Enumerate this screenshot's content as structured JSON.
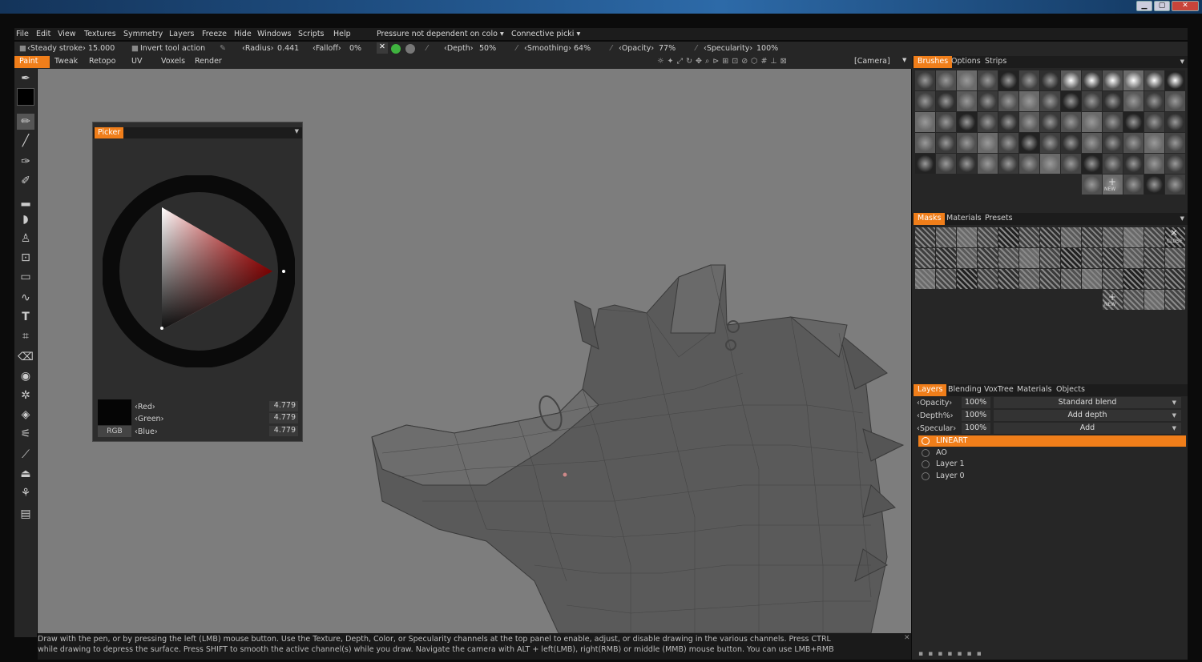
{
  "window": {
    "min": "▁",
    "max": "▢",
    "close": "✕"
  },
  "menu": [
    "File",
    "Edit",
    "View",
    "Textures",
    "Symmetry",
    "Layers",
    "Freeze",
    "Hide",
    "Windows",
    "Scripts",
    "Help"
  ],
  "pressure": "Pressure not dependent on colo",
  "connective": "Connective picki",
  "toolbar": {
    "steady": "Steady stroke",
    "steady_val": "15.000",
    "invert": "Invert tool action",
    "radius": "Radius",
    "radius_val": "0.441",
    "falloff": "Falloff",
    "falloff_val": "0%",
    "depth": "Depth",
    "depth_val": "50%",
    "smoothing": "Smoothing",
    "smoothing_val": "64%",
    "opacity": "Opacity",
    "opacity_val": "77%",
    "specularity": "Specularity",
    "specularity_val": "100%",
    "camera": "[Camera]"
  },
  "modes": [
    "Paint",
    "Tweak",
    "Retopo",
    "UV",
    "Voxels",
    "Render"
  ],
  "picker": {
    "title": "Picker",
    "red_label": "Red",
    "green_label": "Green",
    "blue_label": "Blue",
    "red": "4.779",
    "green": "4.779",
    "blue": "4.779",
    "mode": "RGB"
  },
  "brush_tabs": [
    "Brushes",
    "Options",
    "Strips"
  ],
  "brush_new": "NEW",
  "mask_tabs": [
    "Masks",
    "Materials",
    "Presets"
  ],
  "mask_close": "CLOSE",
  "mask_new": "NEW",
  "layer_tabs": [
    "Layers",
    "Blending",
    "VoxTree",
    "Materials",
    "Objects"
  ],
  "layer_props": {
    "opacity": "Opacity",
    "opacity_val": "100%",
    "opacity_mode": "Standard blend",
    "depth": "Depth%",
    "depth_val": "100%",
    "depth_mode": "Add depth",
    "specular": "Specular",
    "specular_val": "100%",
    "specular_mode": "Add"
  },
  "layers": [
    "LINEART",
    "AO",
    "Layer 1",
    "Layer 0"
  ],
  "status": {
    "line1": "Draw with the pen, or by pressing the left (LMB) mouse button. Use the Texture, Depth, Color, or Specularity channels at the top panel to enable, adjust, or disable drawing in the various channels. Press CTRL",
    "line2": "while drawing to depress the surface. Press SHIFT to smooth the active channel(s) while you draw. Navigate the camera with ALT + left(LMB), right(RMB)  or middle (MMB) mouse button. You can use LMB+RMB"
  },
  "colors": {
    "accent": "#f07e1a",
    "viewport": "#7d7d7d",
    "panel": "#262626"
  }
}
